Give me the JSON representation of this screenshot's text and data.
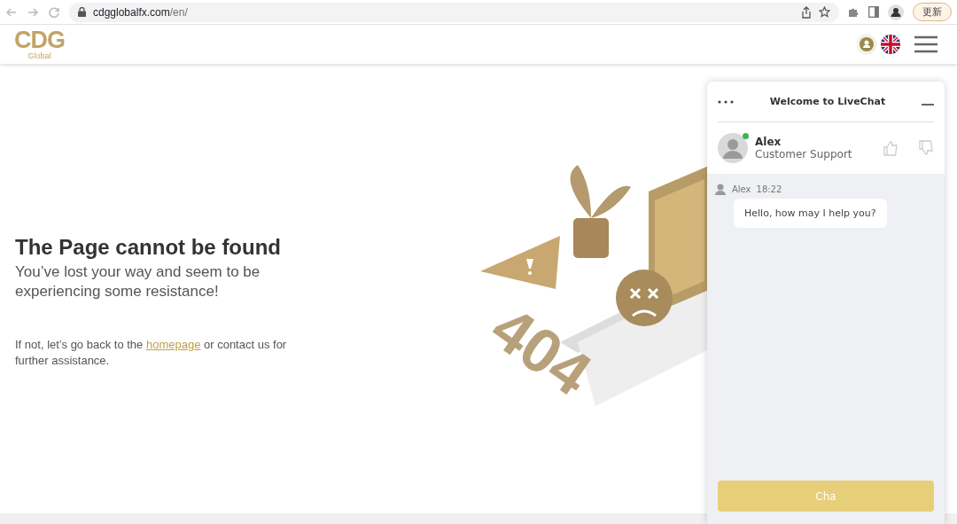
{
  "browser": {
    "url_host": "cdgglobalfx.com",
    "url_path": "/en/",
    "update_button": "更新"
  },
  "header": {
    "logo": "CDG",
    "logo_sub": "Global"
  },
  "error": {
    "title": "The Page cannot be found",
    "subtitle": "You’ve lost your way and seem to be experiencing some resistance!",
    "help_before": "If not, let’s go back to the ",
    "link": "homepage",
    "help_after": " or contact us for further assistance.",
    "illustration_text": "404"
  },
  "chat": {
    "title": "Welcome to LiveChat",
    "agent": {
      "name": "Alex",
      "role": "Customer Support",
      "online": true
    },
    "messages": [
      {
        "author": "Alex",
        "time": "18:22",
        "text": "Hello, how may I help you?"
      }
    ],
    "button": "Cha"
  }
}
